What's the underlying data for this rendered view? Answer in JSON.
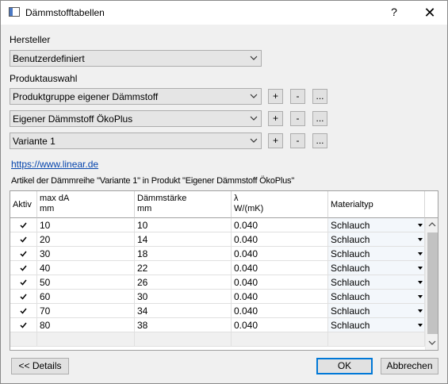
{
  "window": {
    "title": "Dämmstofftabellen",
    "help_label": "?",
    "close_label": "✕"
  },
  "hersteller": {
    "label": "Hersteller",
    "selected": "Benutzerdefiniert"
  },
  "produktauswahl": {
    "label": "Produktauswahl",
    "rows": [
      {
        "selected": "Produktgruppe eigener Dämmstoff"
      },
      {
        "selected": "Eigener Dämmstoff ÖkoPlus"
      },
      {
        "selected": "Variante 1"
      }
    ],
    "add_label": "+",
    "remove_label": "-",
    "more_label": "..."
  },
  "link": {
    "text": "https://www.linear.de"
  },
  "table": {
    "caption": "Artikel der Dämmreihe \"Variante 1\" in Produkt \"Eigener Dämmstoff ÖkoPlus\"",
    "headers": {
      "aktiv": "Aktiv",
      "maxda_1": "max dA",
      "maxda_2": "mm",
      "staerke_1": "Dämmstärke",
      "staerke_2": "mm",
      "lambda_1": "λ",
      "lambda_2": "W/(mK)",
      "materialtyp": "Materialtyp"
    },
    "rows": [
      {
        "aktiv": true,
        "maxda": "10",
        "staerke": "10",
        "lambda": "0.040",
        "material": "Schlauch"
      },
      {
        "aktiv": true,
        "maxda": "20",
        "staerke": "14",
        "lambda": "0.040",
        "material": "Schlauch"
      },
      {
        "aktiv": true,
        "maxda": "30",
        "staerke": "18",
        "lambda": "0.040",
        "material": "Schlauch"
      },
      {
        "aktiv": true,
        "maxda": "40",
        "staerke": "22",
        "lambda": "0.040",
        "material": "Schlauch"
      },
      {
        "aktiv": true,
        "maxda": "50",
        "staerke": "26",
        "lambda": "0.040",
        "material": "Schlauch"
      },
      {
        "aktiv": true,
        "maxda": "60",
        "staerke": "30",
        "lambda": "0.040",
        "material": "Schlauch"
      },
      {
        "aktiv": true,
        "maxda": "70",
        "staerke": "34",
        "lambda": "0.040",
        "material": "Schlauch"
      },
      {
        "aktiv": true,
        "maxda": "80",
        "staerke": "38",
        "lambda": "0.040",
        "material": "Schlauch"
      }
    ]
  },
  "footer": {
    "details_label": "<< Details",
    "ok_label": "OK",
    "cancel_label": "Abbrechen"
  },
  "colors": {
    "window_bg": "#f0f0f0",
    "link": "#0645ad",
    "default_button_border": "#0078d7"
  }
}
